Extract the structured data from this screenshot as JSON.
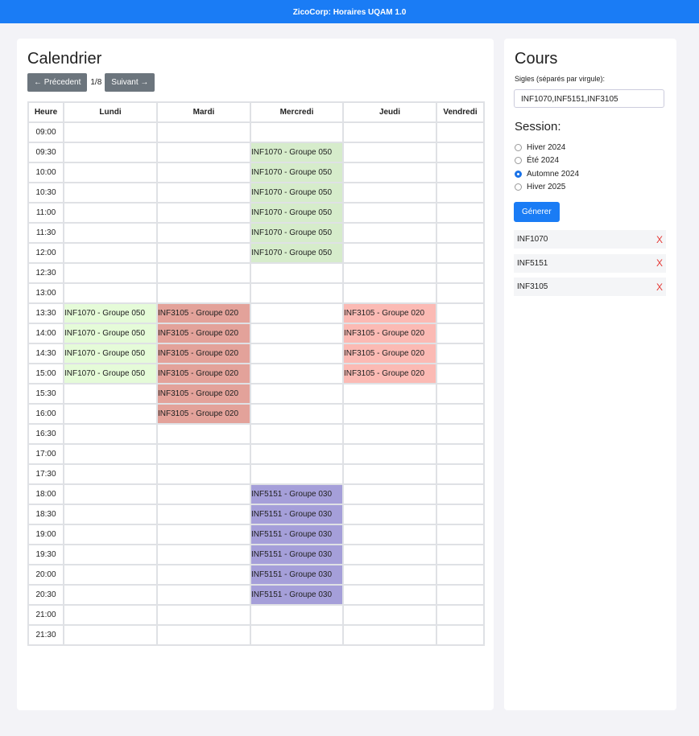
{
  "header": {
    "title": "ZicoCorp: Horaires UQAM 1.0"
  },
  "calendar": {
    "title": "Calendrier",
    "prev_label": "← Précedent",
    "page": "1/8",
    "next_label": "Suivant →",
    "columns": [
      "Heure",
      "Lundi",
      "Mardi",
      "Mercredi",
      "Jeudi",
      "Vendredi"
    ],
    "rows": [
      {
        "time": "09:00",
        "cells": [
          "",
          "",
          "",
          "",
          ""
        ]
      },
      {
        "time": "09:30",
        "cells": [
          "",
          "",
          "INF1070 - Groupe 050",
          "",
          ""
        ]
      },
      {
        "time": "10:00",
        "cells": [
          "",
          "",
          "INF1070 - Groupe 050",
          "",
          ""
        ]
      },
      {
        "time": "10:30",
        "cells": [
          "",
          "",
          "INF1070 - Groupe 050",
          "",
          ""
        ]
      },
      {
        "time": "11:00",
        "cells": [
          "",
          "",
          "INF1070 - Groupe 050",
          "",
          ""
        ]
      },
      {
        "time": "11:30",
        "cells": [
          "",
          "",
          "INF1070 - Groupe 050",
          "",
          ""
        ]
      },
      {
        "time": "12:00",
        "cells": [
          "",
          "",
          "INF1070 - Groupe 050",
          "",
          ""
        ]
      },
      {
        "time": "12:30",
        "cells": [
          "",
          "",
          "",
          "",
          ""
        ]
      },
      {
        "time": "13:00",
        "cells": [
          "",
          "",
          "",
          "",
          ""
        ]
      },
      {
        "time": "13:30",
        "cells": [
          "INF1070 - Groupe 050",
          "INF3105 - Groupe 020",
          "",
          "INF3105 - Groupe 020",
          ""
        ]
      },
      {
        "time": "14:00",
        "cells": [
          "INF1070 - Groupe 050",
          "INF3105 - Groupe 020",
          "",
          "INF3105 - Groupe 020",
          ""
        ]
      },
      {
        "time": "14:30",
        "cells": [
          "INF1070 - Groupe 050",
          "INF3105 - Groupe 020",
          "",
          "INF3105 - Groupe 020",
          ""
        ]
      },
      {
        "time": "15:00",
        "cells": [
          "INF1070 - Groupe 050",
          "INF3105 - Groupe 020",
          "",
          "INF3105 - Groupe 020",
          ""
        ]
      },
      {
        "time": "15:30",
        "cells": [
          "",
          "INF3105 - Groupe 020",
          "",
          "",
          ""
        ]
      },
      {
        "time": "16:00",
        "cells": [
          "",
          "INF3105 - Groupe 020",
          "",
          "",
          ""
        ]
      },
      {
        "time": "16:30",
        "cells": [
          "",
          "",
          "",
          "",
          ""
        ]
      },
      {
        "time": "17:00",
        "cells": [
          "",
          "",
          "",
          "",
          ""
        ]
      },
      {
        "time": "17:30",
        "cells": [
          "",
          "",
          "",
          "",
          ""
        ]
      },
      {
        "time": "18:00",
        "cells": [
          "",
          "",
          "INF5151 - Groupe 030",
          "",
          ""
        ]
      },
      {
        "time": "18:30",
        "cells": [
          "",
          "",
          "INF5151 - Groupe 030",
          "",
          ""
        ]
      },
      {
        "time": "19:00",
        "cells": [
          "",
          "",
          "INF5151 - Groupe 030",
          "",
          ""
        ]
      },
      {
        "time": "19:30",
        "cells": [
          "",
          "",
          "INF5151 - Groupe 030",
          "",
          ""
        ]
      },
      {
        "time": "20:00",
        "cells": [
          "",
          "",
          "INF5151 - Groupe 030",
          "",
          ""
        ]
      },
      {
        "time": "20:30",
        "cells": [
          "",
          "",
          "INF5151 - Groupe 030",
          "",
          ""
        ]
      },
      {
        "time": "21:00",
        "cells": [
          "",
          "",
          "",
          "",
          ""
        ]
      },
      {
        "time": "21:30",
        "cells": [
          "",
          "",
          "",
          "",
          ""
        ]
      }
    ],
    "colors": {
      "INF1070-Mercredi": "#d6eccb",
      "INF1070-Lundi": "#e5fbd8",
      "INF3105-Mardi": "#e3a29a",
      "INF3105-Jeudi": "#fbbab4",
      "INF5151-Mercredi": "#a59fd9"
    }
  },
  "sidebar": {
    "title": "Cours",
    "sigles_label": "Sigles (séparés par virgule):",
    "sigles_value": "INF1070,INF5151,INF3105",
    "session_title": "Session:",
    "sessions": [
      {
        "label": "Hiver 2024",
        "checked": false
      },
      {
        "label": "Été 2024",
        "checked": false
      },
      {
        "label": "Automne 2024",
        "checked": true
      },
      {
        "label": "Hiver 2025",
        "checked": false
      }
    ],
    "generate_label": "Génerer",
    "courses": [
      "INF1070",
      "INF5151",
      "INF3105"
    ],
    "remove_label": "X"
  }
}
